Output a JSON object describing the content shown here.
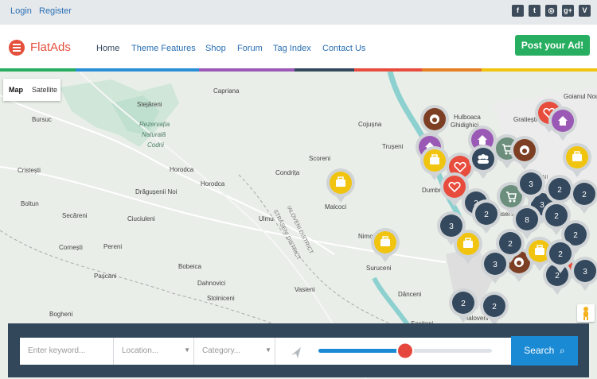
{
  "topbar": {
    "login": "Login",
    "register": "Register"
  },
  "social": [
    {
      "name": "facebook-icon",
      "glyph": "f"
    },
    {
      "name": "twitter-icon",
      "glyph": "t"
    },
    {
      "name": "dribbble-icon",
      "glyph": "◎"
    },
    {
      "name": "googleplus-icon",
      "glyph": "g+"
    },
    {
      "name": "vimeo-icon",
      "glyph": "V"
    }
  ],
  "brand": {
    "name": "FlatAds",
    "accent": "#e4503c"
  },
  "nav": [
    "Home",
    "Theme Features",
    "Shop",
    "Forum",
    "Tag Index",
    "Contact Us"
  ],
  "post_ad": "Post your Ad!",
  "map_type": {
    "map": "Map",
    "satellite": "Satellite"
  },
  "map_labels": [
    "Capriana",
    "Stejăreni",
    "Bursuc",
    "Rezervația",
    "Naturală",
    "Codrii",
    "Cojușna",
    "Hulboaca",
    "Gratiești",
    "Goianul Nou",
    "Trușeni",
    "Scoreni",
    "Horodca",
    "Condrița",
    "Cristești",
    "Drăgușenii Noi",
    "Horodca",
    "Malcoci",
    "Boltun",
    "Ulmu",
    "Secăreni",
    "Ciuciuleni",
    "Nimoreni",
    "Cornești",
    "Pereni",
    "Suruceni",
    "Bobeica",
    "Pașcani",
    "Dahnovici",
    "Stolniceni",
    "Vasieni",
    "Dănceni",
    "Bogheni",
    "Sociteni",
    "Ialoveni",
    "Dumbrava",
    "Ruseni",
    "Ghidighici",
    "RÎȘCANI",
    "STRĂȘENI DISTRICT",
    "IALOVENI DISTRICT"
  ],
  "cluster_counts": [
    "2",
    "2",
    "3",
    "2",
    "3",
    "2",
    "8",
    "3",
    "2",
    "2",
    "3",
    "2",
    "2",
    "2",
    "3",
    "2",
    "2"
  ],
  "search": {
    "keyword_placeholder": "Enter keyword...",
    "location_placeholder": "Location...",
    "category_placeholder": "Category...",
    "button": "Search",
    "distance": 0.5
  },
  "colors": {
    "stripe": [
      "#27ae60",
      "#2a8fd6",
      "#9b59b6",
      "#34495e",
      "#e74c3c",
      "#e67e22",
      "#f1c40f"
    ]
  }
}
